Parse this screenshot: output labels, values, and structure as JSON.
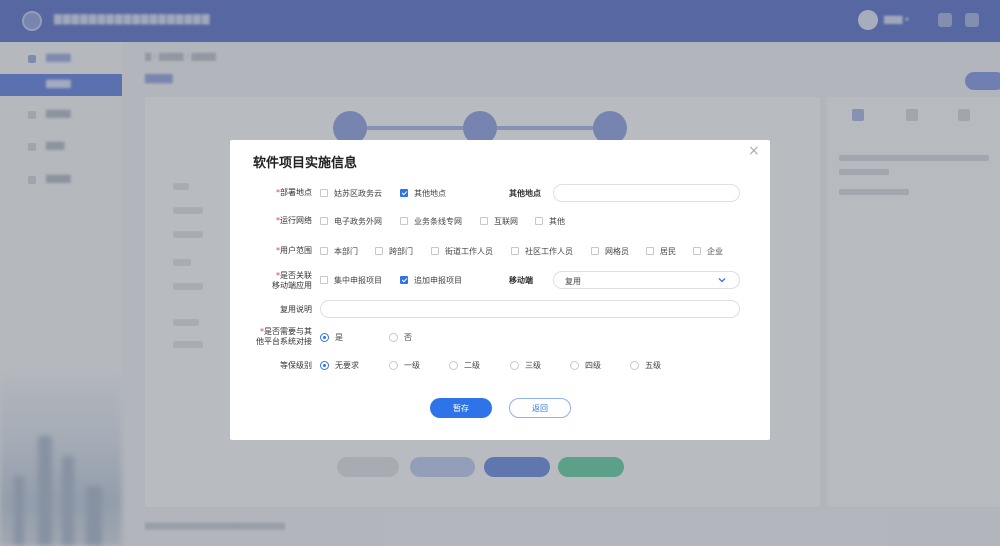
{
  "dialog": {
    "title": "软件项目实施信息",
    "close_symbol": "×",
    "deploy": {
      "label": "部署地点",
      "options": [
        {
          "label": "姑苏区政务云",
          "checked": false
        },
        {
          "label": "其他地点",
          "checked": true
        }
      ],
      "other_label": "其他地点",
      "other_value": ""
    },
    "network": {
      "label": "运行网络",
      "options": [
        {
          "label": "电子政务外网",
          "checked": false
        },
        {
          "label": "业务条线专网",
          "checked": false
        },
        {
          "label": "互联网",
          "checked": false
        },
        {
          "label": "其他",
          "checked": false
        }
      ]
    },
    "users": {
      "label": "用户范围",
      "options": [
        {
          "label": "本部门",
          "checked": false
        },
        {
          "label": "跨部门",
          "checked": false
        },
        {
          "label": "街道工作人员",
          "checked": false
        },
        {
          "label": "社区工作人员",
          "checked": false
        },
        {
          "label": "网格员",
          "checked": false
        },
        {
          "label": "居民",
          "checked": false
        },
        {
          "label": "企业",
          "checked": false
        }
      ]
    },
    "mobile": {
      "label_line1": "是否关联",
      "label_line2": "移动端应用",
      "options": [
        {
          "label": "集中申报项目",
          "checked": false
        },
        {
          "label": "追加申报项目",
          "checked": true
        }
      ],
      "mobile_label": "移动端",
      "mobile_value": "复用"
    },
    "reuse": {
      "label": "复用说明",
      "value": ""
    },
    "docking": {
      "label_line1": "是否需要与其",
      "label_line2": "他平台系统对接",
      "options": [
        {
          "label": "是",
          "checked": true
        },
        {
          "label": "否",
          "checked": false
        }
      ]
    },
    "protection": {
      "label": "等保级别",
      "options": [
        {
          "label": "无要求",
          "checked": true
        },
        {
          "label": "一级",
          "checked": false
        },
        {
          "label": "二级",
          "checked": false
        },
        {
          "label": "三级",
          "checked": false
        },
        {
          "label": "四级",
          "checked": false
        },
        {
          "label": "五级",
          "checked": false
        }
      ]
    },
    "save_label": "暂存",
    "back_label": "返回"
  },
  "colors": {
    "primary": "#2e74e8",
    "required": "#e53935",
    "header": "#2440b8"
  },
  "icons": {
    "chevron": "chevron-down-icon",
    "close": "close-icon"
  }
}
